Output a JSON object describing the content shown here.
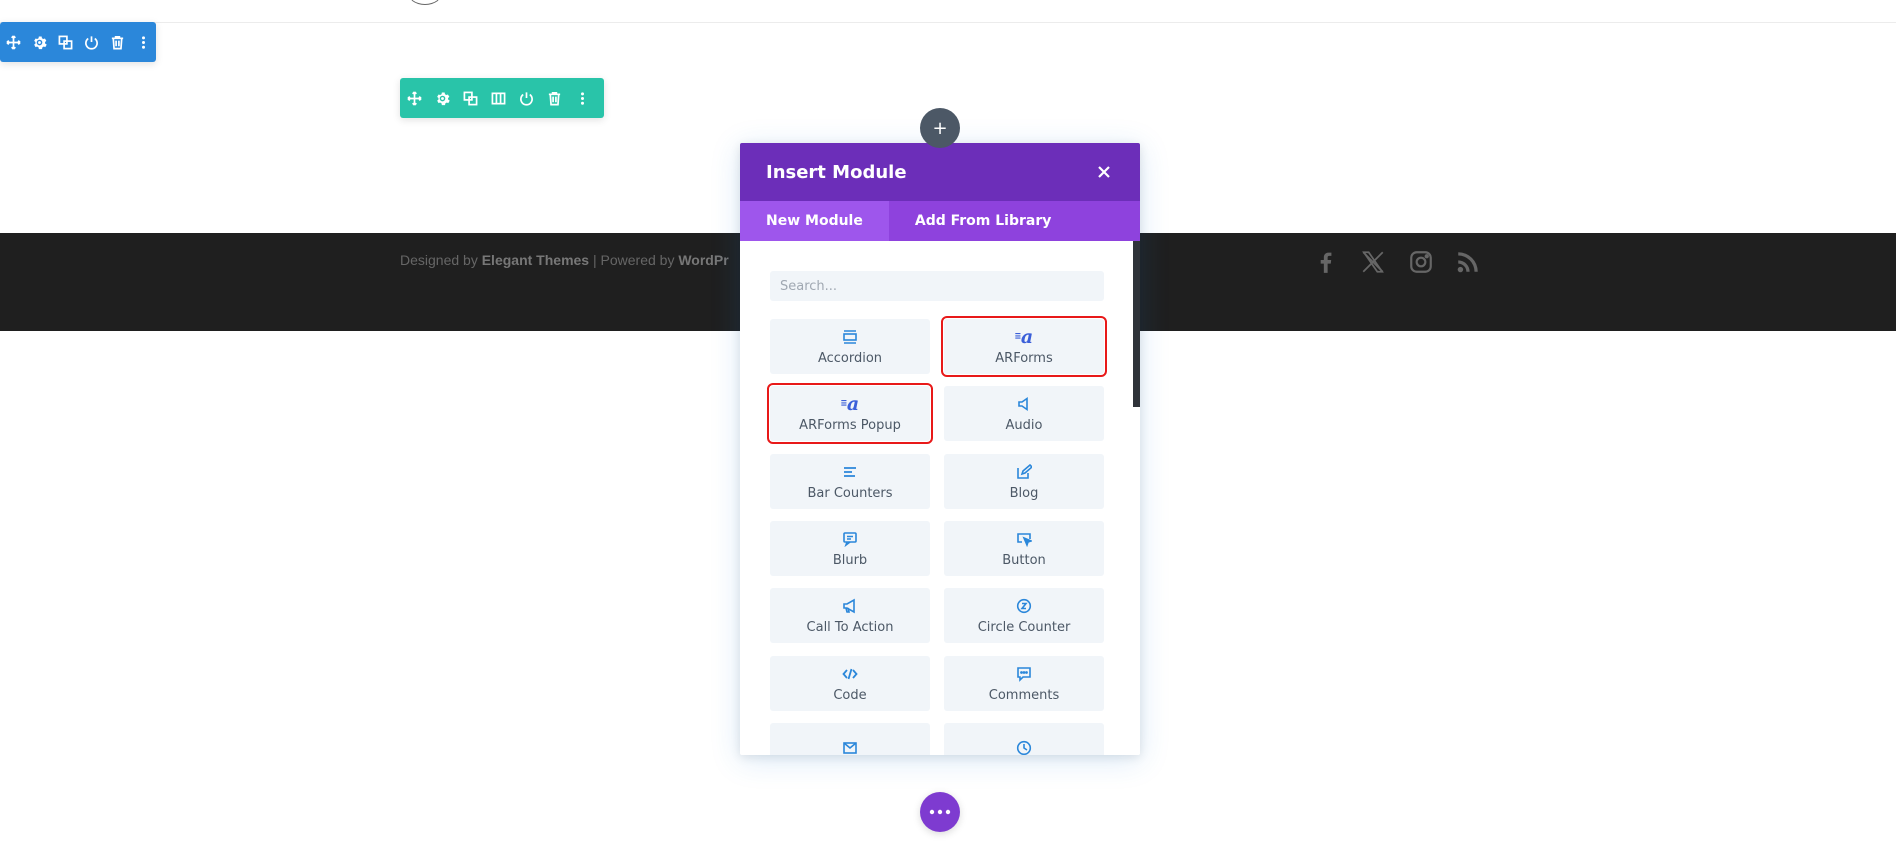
{
  "colors": {
    "section_toolbar": "#2b87da",
    "row_toolbar": "#29c4a9",
    "modal_header": "#6c2eb9",
    "modal_tabs": "#8e42dd",
    "active_tab": "#9e56ec",
    "footer_bg": "#1f1f1f",
    "module_icon": "#2b87da",
    "highlight_outline": "#e81919"
  },
  "section_toolbar": {
    "icons": [
      "move-icon",
      "gear-icon",
      "duplicate-icon",
      "power-icon",
      "trash-icon",
      "more-vertical-icon"
    ]
  },
  "row_toolbar": {
    "icons": [
      "move-icon",
      "gear-icon",
      "duplicate-icon",
      "columns-icon",
      "power-icon",
      "trash-icon",
      "more-vertical-icon"
    ]
  },
  "footer": {
    "designed_by": "Designed by",
    "elegant_themes": "Elegant Themes",
    "separator": "|",
    "powered_by": "Powered by",
    "wordpress": "WordPr",
    "social_icons": [
      "facebook-icon",
      "x-icon",
      "instagram-icon",
      "rss-icon"
    ]
  },
  "plus_button": {
    "label": "+"
  },
  "modal": {
    "title": "Insert Module",
    "tabs": [
      {
        "label": "New Module",
        "active": true
      },
      {
        "label": "Add From Library",
        "active": false
      }
    ],
    "search": {
      "placeholder": "Search...",
      "value": ""
    },
    "modules": [
      {
        "label": "Accordion",
        "icon": "accordion-icon",
        "highlighted": false
      },
      {
        "label": "ARForms",
        "icon": "arforms-icon",
        "highlighted": true
      },
      {
        "label": "ARForms Popup",
        "icon": "arforms-icon",
        "highlighted": true
      },
      {
        "label": "Audio",
        "icon": "speaker-icon",
        "highlighted": false
      },
      {
        "label": "Bar Counters",
        "icon": "bar-counters-icon",
        "highlighted": false
      },
      {
        "label": "Blog",
        "icon": "blog-edit-icon",
        "highlighted": false
      },
      {
        "label": "Blurb",
        "icon": "blurb-icon",
        "highlighted": false
      },
      {
        "label": "Button",
        "icon": "button-cursor-icon",
        "highlighted": false
      },
      {
        "label": "Call To Action",
        "icon": "megaphone-icon",
        "highlighted": false
      },
      {
        "label": "Circle Counter",
        "icon": "circle-counter-icon",
        "highlighted": false
      },
      {
        "label": "Code",
        "icon": "code-icon",
        "highlighted": false
      },
      {
        "label": "Comments",
        "icon": "comments-icon",
        "highlighted": false
      },
      {
        "label": "",
        "icon": "envelope-icon",
        "highlighted": false
      },
      {
        "label": "",
        "icon": "clock-icon",
        "highlighted": false
      }
    ]
  },
  "more_button": {
    "icon": "more-horizontal-icon"
  }
}
